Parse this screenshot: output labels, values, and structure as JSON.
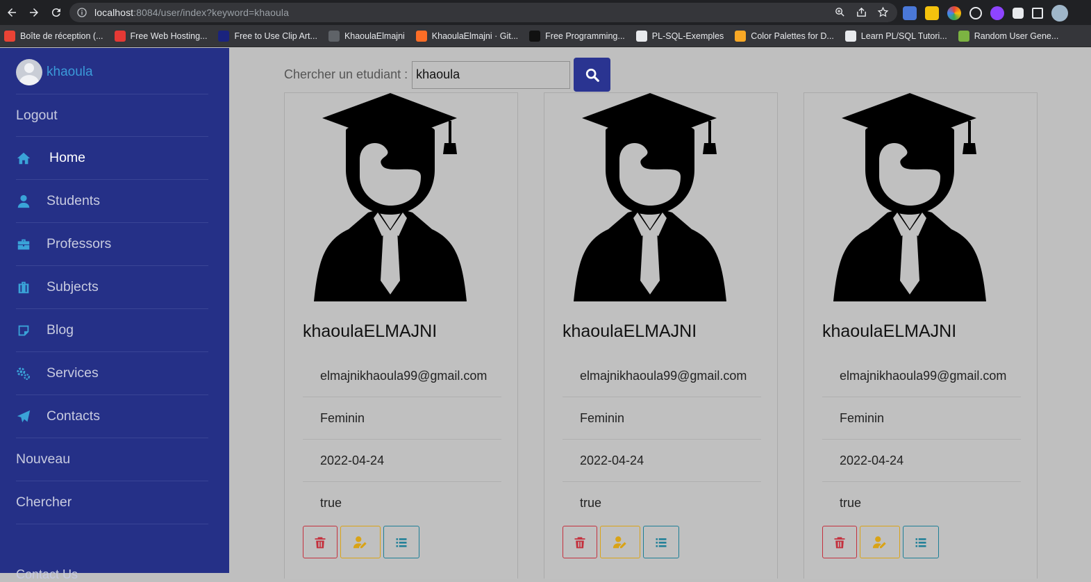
{
  "browser": {
    "url_host": "localhost",
    "url_path": ":8084/user/index?keyword=khaoula",
    "bookmarks": [
      {
        "label": "Boîte de réception (...",
        "color": "#ea4335"
      },
      {
        "label": "Free Web Hosting...",
        "color": "#e53935"
      },
      {
        "label": "Free to Use Clip Art...",
        "color": "#1a237e"
      },
      {
        "label": "KhaoulaElmajni",
        "color": "#5f6368"
      },
      {
        "label": "KhaoulaElmajni · Git...",
        "color": "#fc6d26"
      },
      {
        "label": "Free Programming...",
        "color": "#111111"
      },
      {
        "label": "PL-SQL-Exemples",
        "color": "#e8eaed"
      },
      {
        "label": "Color Palettes for D...",
        "color": "#f9a825"
      },
      {
        "label": "Learn PL/SQL Tutori...",
        "color": "#e8eaed"
      },
      {
        "label": "Random User Gene...",
        "color": "#7cb342"
      }
    ]
  },
  "sidebar": {
    "username": "khaoula",
    "items": [
      {
        "label": "Logout",
        "icon": ""
      },
      {
        "label": "Home",
        "icon": "home-icon"
      },
      {
        "label": "Students",
        "icon": "user-icon"
      },
      {
        "label": "Professors",
        "icon": "briefcase-icon"
      },
      {
        "label": "Subjects",
        "icon": "suitcase-icon"
      },
      {
        "label": "Blog",
        "icon": "note-icon"
      },
      {
        "label": "Services",
        "icon": "cogs-icon"
      },
      {
        "label": "Contacts",
        "icon": "paper-plane-icon"
      },
      {
        "label": "Nouveau",
        "icon": ""
      },
      {
        "label": "Chercher",
        "icon": ""
      }
    ],
    "footer": "Contact Us"
  },
  "search": {
    "label": "Chercher un etudiant :",
    "value": "khaoula"
  },
  "students": [
    {
      "name": "khaoulaELMAJNI",
      "email": "elmajnikhaoula99@gmail.com",
      "gender": "Feminin",
      "date": "2022-04-24",
      "status": "true"
    },
    {
      "name": "khaoulaELMAJNI",
      "email": "elmajnikhaoula99@gmail.com",
      "gender": "Feminin",
      "date": "2022-04-24",
      "status": "true"
    },
    {
      "name": "khaoulaELMAJNI",
      "email": "elmajnikhaoula99@gmail.com",
      "gender": "Feminin",
      "date": "2022-04-24",
      "status": "true"
    }
  ],
  "colors": {
    "sidebar_bg": "#253087",
    "accent": "#3aa3d8",
    "search_btn": "#2a3491",
    "danger": "#c4303d",
    "warning": "#d9a317",
    "info": "#1c7e96"
  }
}
